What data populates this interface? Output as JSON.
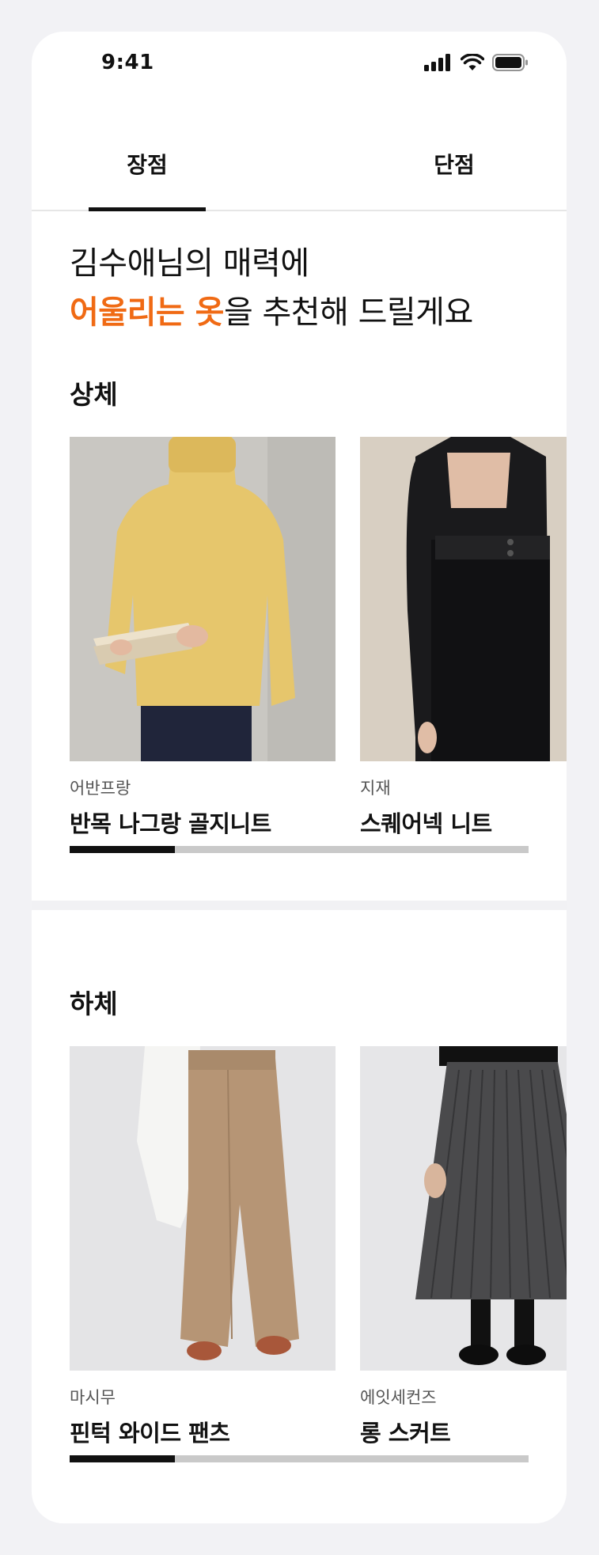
{
  "status_bar": {
    "time": "9:41"
  },
  "tabs": [
    {
      "label": "장점",
      "active": true
    },
    {
      "label": "단점",
      "active": false
    }
  ],
  "headline": {
    "line1": "김수애님의 매력에",
    "line2_accent": "어울리는 옷",
    "line2_rest": "을 추천해 드릴게요"
  },
  "colors": {
    "accent": "#f06a14",
    "text": "#111111",
    "progress_track": "#c9c9c9"
  },
  "sections": [
    {
      "title": "상체",
      "products": [
        {
          "brand": "어반프랑",
          "name": "반목 나그랑 골지니트"
        },
        {
          "brand": "지재",
          "name": "스퀘어넥 니트"
        }
      ],
      "progress": 0.23
    },
    {
      "title": "하체",
      "products": [
        {
          "brand": "마시무",
          "name": "핀턱 와이드 팬츠"
        },
        {
          "brand": "에잇세컨즈",
          "name": "롱 스커트"
        }
      ],
      "progress": 0.23
    }
  ]
}
